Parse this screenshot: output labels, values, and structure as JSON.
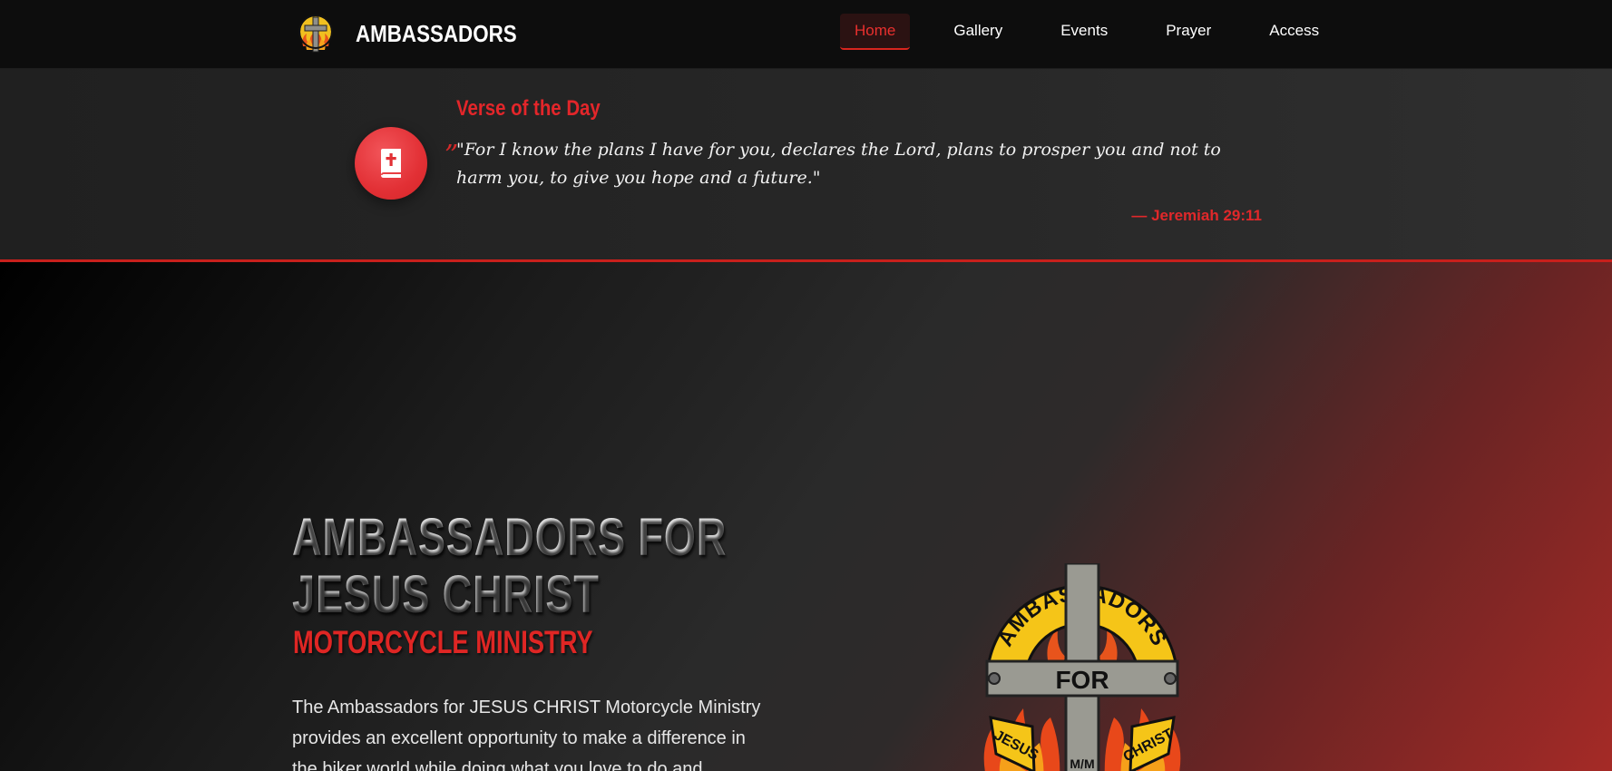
{
  "nav": {
    "brand_name": "AMBASSADORS",
    "links": [
      {
        "label": "Home",
        "active": true
      },
      {
        "label": "Gallery",
        "active": false
      },
      {
        "label": "Events",
        "active": false
      },
      {
        "label": "Prayer",
        "active": false
      },
      {
        "label": "Access",
        "active": false
      }
    ]
  },
  "verse": {
    "heading": "Verse of the Day",
    "icon": "bible-icon",
    "quote_mark": "”",
    "text": "\"For I know the plans I have for you, declares the Lord, plans to prosper you and not to harm you, to give you hope and a future.\"",
    "reference": "— Jeremiah 29:11"
  },
  "hero": {
    "title_line1": "AMBASSADORS FOR",
    "title_line2": "JESUS CHRIST",
    "subtitle": "MOTORCYCLE MINISTRY",
    "description": "The Ambassadors for JESUS CHRIST Motorcycle Ministry provides an excellent opportunity to make a difference in the biker world while doing what you love to do and..."
  },
  "logo": {
    "arc_text": "AMBASSADORS",
    "center_text": "FOR",
    "left_text": "JESUS",
    "right_text": "CHRIST",
    "bottom_text": "M/M"
  },
  "colors": {
    "accent": "#e3262a",
    "nav_bg": "#0d0d0d",
    "verse_bg": "#262626",
    "logo_yellow": "#f5c518",
    "cross_gray": "#9a9a92"
  }
}
